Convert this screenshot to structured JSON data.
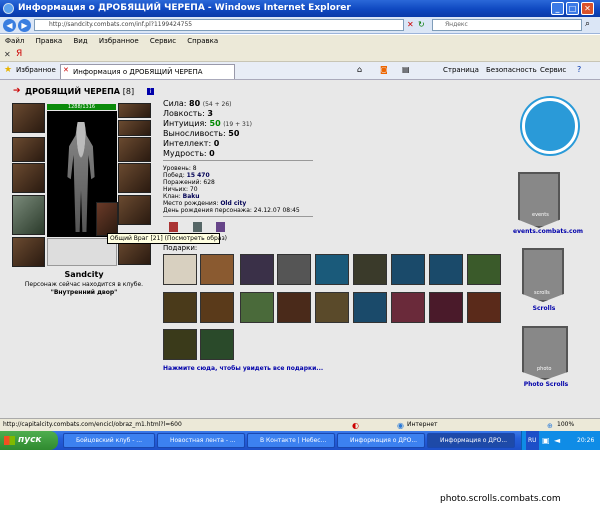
{
  "window": {
    "title": "Информация о ДРОБЯЩИЙ ЧЕРЕПА - Windows Internet Explorer"
  },
  "address": {
    "url": "http://sandcity.combats.com/inf.pl?1199424755",
    "search_placeholder": "Яндекс"
  },
  "menu": [
    "Файл",
    "Правка",
    "Вид",
    "Избранное",
    "Сервис",
    "Справка"
  ],
  "tabs": {
    "favorites": "Избранное",
    "active": "Информация о ДРОБЯЩИЙ ЧЕРЕПА"
  },
  "toolbar": {
    "page": "Страница",
    "security": "Безопасность",
    "service": "Сервис"
  },
  "character": {
    "name": "ДРОБЯЩИЙ ЧЕРЕПА",
    "level": "[8]",
    "hp": "1288/1316",
    "nick": "Sandcity",
    "location_text": "Персонаж сейчас находится в клубе.",
    "location_room": "\"Внутренний двор\"",
    "tooltip": "Общий Враг [21] (Посмотреть образ)"
  },
  "stats": [
    {
      "label": "Сила:",
      "value": "80",
      "bonus": "(54 + 26)"
    },
    {
      "label": "Ловкость:",
      "value": "3",
      "bonus": ""
    },
    {
      "label": "Интуиция:",
      "value": "50",
      "bonus": "(19 + 31)"
    },
    {
      "label": "Выносливость:",
      "value": "50",
      "bonus": ""
    },
    {
      "label": "Интеллект:",
      "value": "0",
      "bonus": ""
    },
    {
      "label": "Мудрость:",
      "value": "0",
      "bonus": ""
    }
  ],
  "info": {
    "level": "Уровень: 8",
    "wins_label": "Побед: ",
    "wins": "15 470",
    "losses": "Поражений: 628",
    "draws": "Ничьих: 70",
    "clan_label": "Клан: ",
    "clan": "Baku",
    "birthplace_label": "Место рождения: ",
    "birthplace": "Old city",
    "birthday": "День рождения персонажа: 24.12.07 08:45"
  },
  "gifts": {
    "title": "Подарки:",
    "link": "Нажмите сюда, чтобы увидеть все подарки..."
  },
  "right": {
    "events": "events.combats.com",
    "scrolls": "Scrolls",
    "photo": "Photo Scrolls",
    "events_word": "events",
    "scrolls_word": "scrolls",
    "photo_word": "photo"
  },
  "status": {
    "url": "http://capitalcity.combats.com/encicl/obraz_m1.html?l=600",
    "zone": "Интернет",
    "zoom": "100%"
  },
  "taskbar": {
    "start": "пуск",
    "items": [
      "Бойцовский клуб - ...",
      "Новостная лента - ...",
      "В Контакте | Небес...",
      "Информация о ДРО...",
      "Информация о ДРО..."
    ],
    "lang": "RU",
    "time": "20:26"
  },
  "watermark": "photo.scrolls.combats.com"
}
